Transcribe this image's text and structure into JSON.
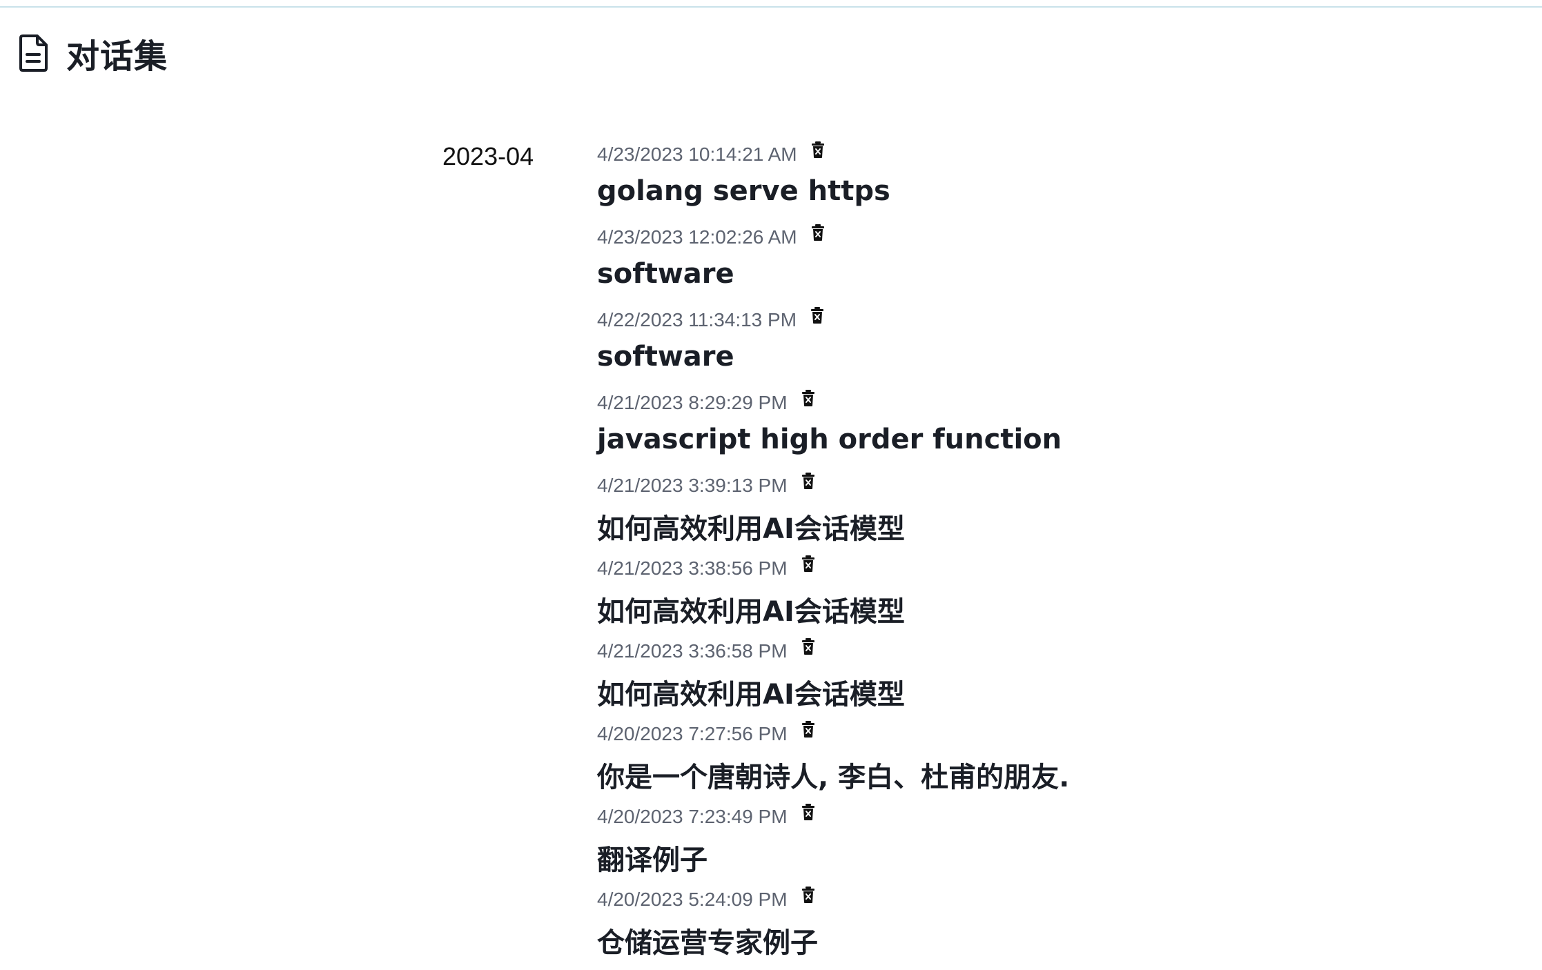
{
  "header": {
    "icon": "document-icon",
    "title": "对话集"
  },
  "groups": [
    {
      "month": "2023-04",
      "conversations": [
        {
          "time": "4/23/2023 10:14:21 AM",
          "title": "golang serve https"
        },
        {
          "time": "4/23/2023 12:02:26 AM",
          "title": "software"
        },
        {
          "time": "4/22/2023 11:34:13 PM",
          "title": "software"
        },
        {
          "time": "4/21/2023 8:29:29 PM",
          "title": "javascript high order function"
        },
        {
          "time": "4/21/2023 3:39:13 PM",
          "title": "如何高效利用AI会话模型"
        },
        {
          "time": "4/21/2023 3:38:56 PM",
          "title": "如何高效利用AI会话模型"
        },
        {
          "time": "4/21/2023 3:36:58 PM",
          "title": "如何高效利用AI会话模型"
        },
        {
          "time": "4/20/2023 7:27:56 PM",
          "title": "你是一个唐朝诗人, 李白、杜甫的朋友."
        },
        {
          "time": "4/20/2023 7:23:49 PM",
          "title": "翻译例子"
        },
        {
          "time": "4/20/2023 5:24:09 PM",
          "title": "仓储运营专家例子"
        }
      ]
    }
  ],
  "colors": {
    "text": "#1a1e26",
    "muted": "#5d6370",
    "top_rule": "#c9e2ea"
  }
}
